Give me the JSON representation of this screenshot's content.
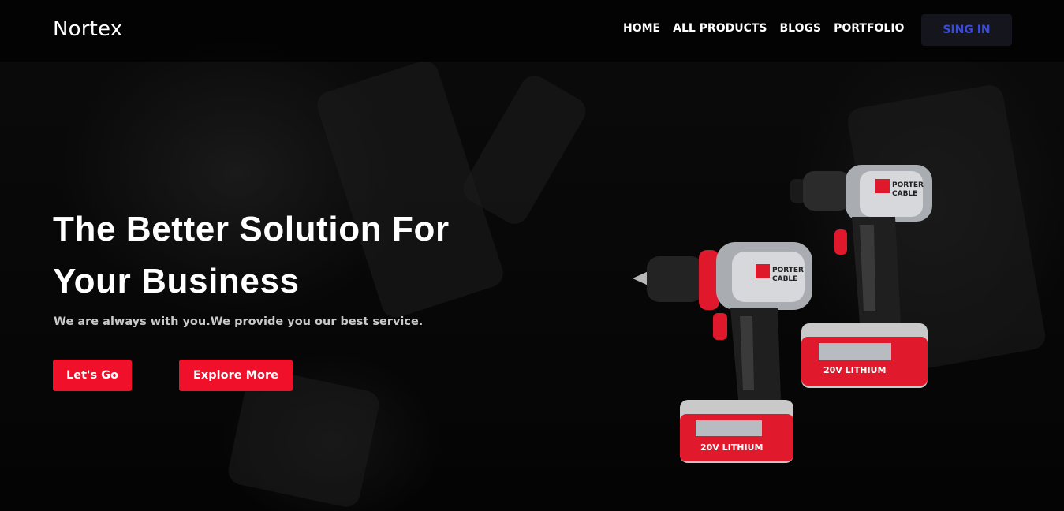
{
  "navbar": {
    "logo": "Nortex",
    "links": [
      "HOME",
      "ALL PRODUCTS",
      "BLOGS",
      "PORTFOLIO"
    ],
    "signin_label": "SING IN"
  },
  "hero": {
    "title_line1": "The Better Solution For",
    "title_line2": "Your Business",
    "subtitle": "We are always with you.We provide you our best service.",
    "primary_button": "Let's Go",
    "secondary_button": "Explore More"
  },
  "product_image": {
    "brand_lines": [
      "PORTER",
      "CABLE"
    ],
    "battery_label": "20V LITHIUM"
  },
  "colors": {
    "accent_red": "#f0102a",
    "signin_text": "#3a4bd8",
    "signin_bg": "#14151d",
    "background": "#050505"
  }
}
